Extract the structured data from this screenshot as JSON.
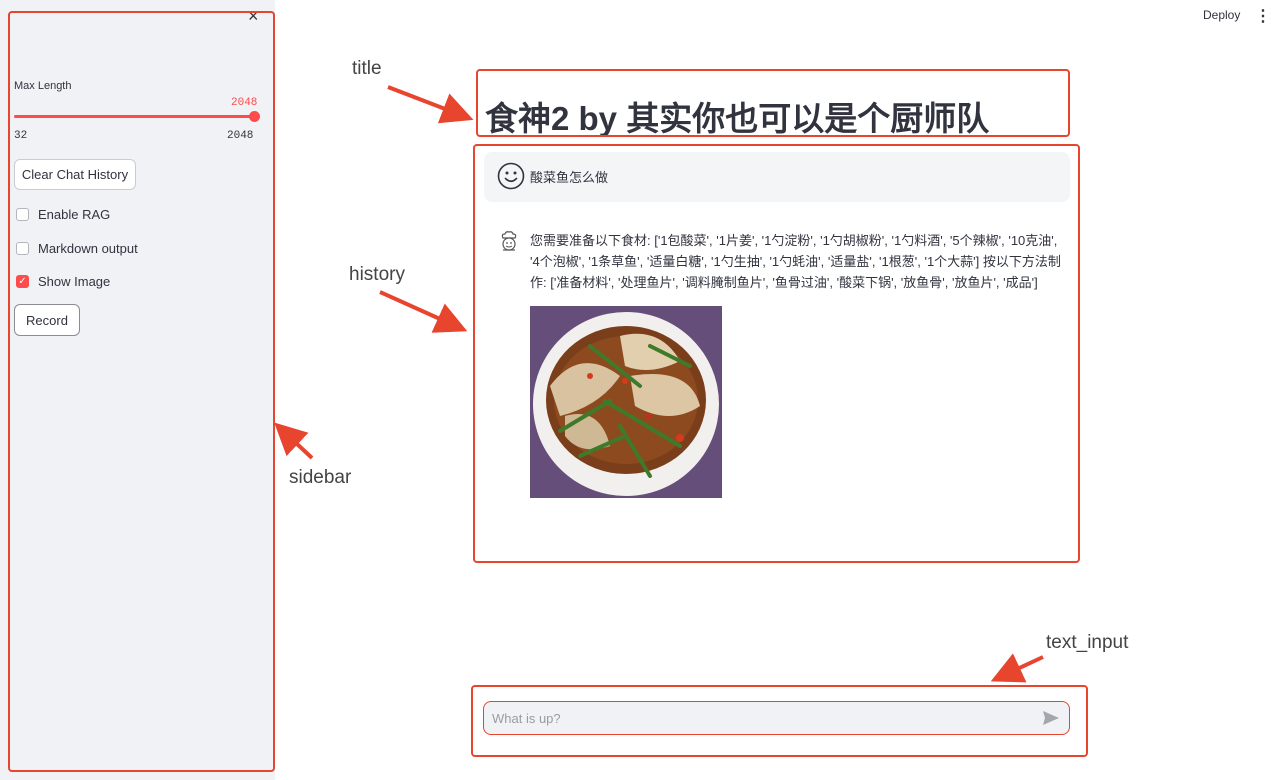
{
  "header": {
    "deploy_label": "Deploy",
    "menu_icon": "more-vertical-icon"
  },
  "sidebar": {
    "close_icon": "close-icon",
    "slider": {
      "label": "Max Length",
      "value": 2048,
      "value_text": "2048",
      "min_text": "32",
      "max_text": "2048",
      "min": 32,
      "max": 2048
    },
    "clear_button": "Clear Chat History",
    "checkboxes": [
      {
        "label": "Enable RAG",
        "checked": false
      },
      {
        "label": "Markdown output",
        "checked": false
      },
      {
        "label": "Show Image",
        "checked": true
      }
    ],
    "record_button": "Record"
  },
  "main": {
    "title": "食神2 by 其实你也可以是个厨师队",
    "messages": [
      {
        "role": "user",
        "avatar": "smiley-icon",
        "text": "酸菜鱼怎么做"
      },
      {
        "role": "assistant",
        "avatar": "chef-icon",
        "text": "您需要准备以下食材: ['1包酸菜', '1片姜', '1勺淀粉', '1勺胡椒粉', '1勺料酒', '5个辣椒', '10克油', '4个泡椒', '1条草鱼', '适量白糖', '1勺生抽', '1勺蚝油', '适量盐', '1根葱', '1个大蒜'] 按以下方法制作: ['准备材料', '处理鱼片', '调料腌制鱼片', '鱼骨过油', '酸菜下锅', '放鱼骨', '放鱼片', '成品']",
        "image": "pickled-fish-dish-photo"
      }
    ],
    "input_placeholder": "What is up?",
    "send_icon": "send-icon"
  },
  "annotations": {
    "title": "title",
    "history": "history",
    "sidebar": "sidebar",
    "text_input": "text_input"
  },
  "colors": {
    "accent": "#ff4b4b",
    "annotation_red": "#e8452e",
    "sidebar_bg": "#f0f2f6"
  }
}
